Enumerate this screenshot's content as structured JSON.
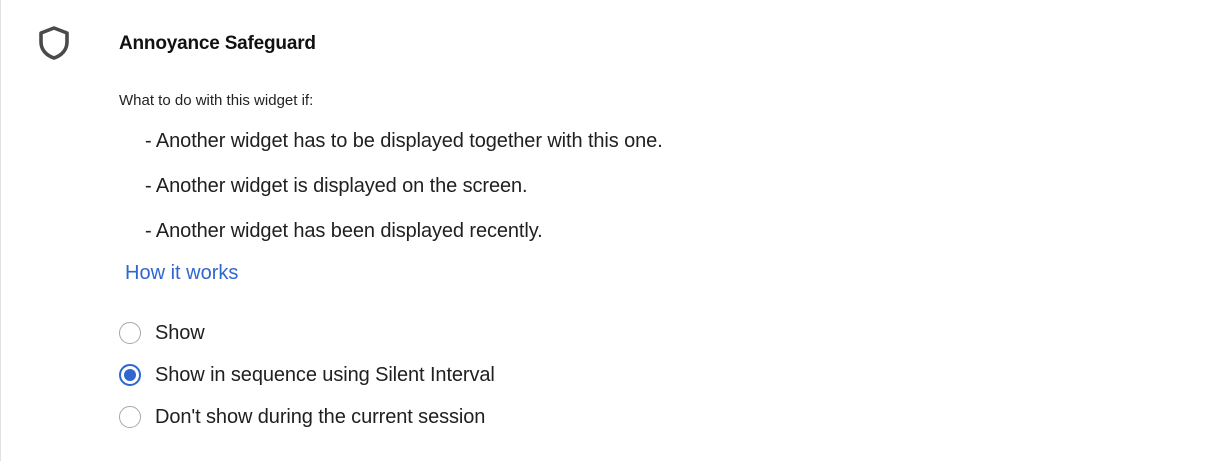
{
  "section": {
    "title": "Annoyance Safeguard",
    "icon": "shield-icon",
    "intro": "What to do with this widget if:",
    "conditions": [
      "- Another widget has to be displayed together with this one.",
      "- Another widget is displayed on the screen.",
      "- Another widget has been displayed recently."
    ],
    "link_label": "How it works"
  },
  "options": [
    {
      "label": "Show",
      "checked": false
    },
    {
      "label": "Show in sequence using Silent Interval",
      "checked": true
    },
    {
      "label": "Don't show during the current session",
      "checked": false
    }
  ],
  "colors": {
    "accent": "#2f66d0",
    "text": "#202020",
    "radio_border": "#a8a8a8"
  }
}
